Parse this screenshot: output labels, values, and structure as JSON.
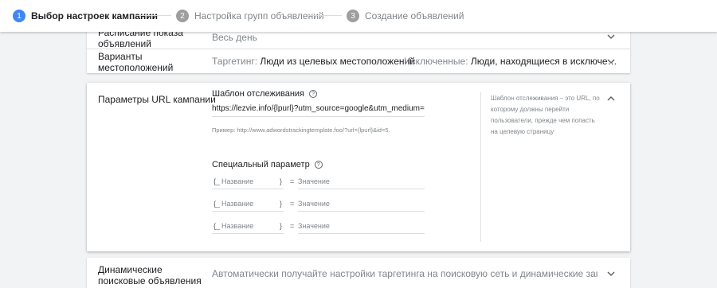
{
  "stepper": {
    "steps": [
      {
        "num": "1",
        "label": "Выбор настроек кампании"
      },
      {
        "num": "2",
        "label": "Настройка групп объявлений"
      },
      {
        "num": "3",
        "label": "Создание объявлений"
      }
    ]
  },
  "settings_rows": [
    {
      "title": "Расписание показа объявлений",
      "value": "Весь день"
    },
    {
      "title": "Варианты местоположений",
      "targeting_label": "Таргетинг:",
      "targeting_value": "Люди из целевых местоположений",
      "excluded_label": "Исключенные:",
      "excluded_value": "Люди, находящиеся в исключе…"
    }
  ],
  "url_params": {
    "title": "Параметры URL кампании",
    "tracking_label": "Шаблон отслеживания",
    "tracking_value": "https://lezvie.info/{lpurl}?utm_source=google&utm_medium=cpc&utm",
    "example": "Пример: http://www.adwordstrackingtemplate.foo/?url={lpurl}&id=5.",
    "custom_param_label": "Специальный параметр",
    "params": [
      {
        "open": "{_",
        "name_placeholder": "Название",
        "close": "}",
        "eq": "=",
        "value_placeholder": "Значение"
      },
      {
        "open": "{_",
        "name_placeholder": "Название",
        "close": "}",
        "eq": "=",
        "value_placeholder": "Значение"
      },
      {
        "open": "{_",
        "name_placeholder": "Название",
        "close": "}",
        "eq": "=",
        "value_placeholder": "Значение"
      }
    ],
    "help_text": "Шаблон отслеживания – это URL, по которому должны перейти пользователи, прежде чем попасть на целевую страницу"
  },
  "dynamic_search": {
    "title": "Динамические поисковые объявления",
    "value": "Автоматически получайте настройки таргетинга на поисковую сеть и динамические заголовки для об"
  },
  "icons": {
    "help": "?"
  }
}
